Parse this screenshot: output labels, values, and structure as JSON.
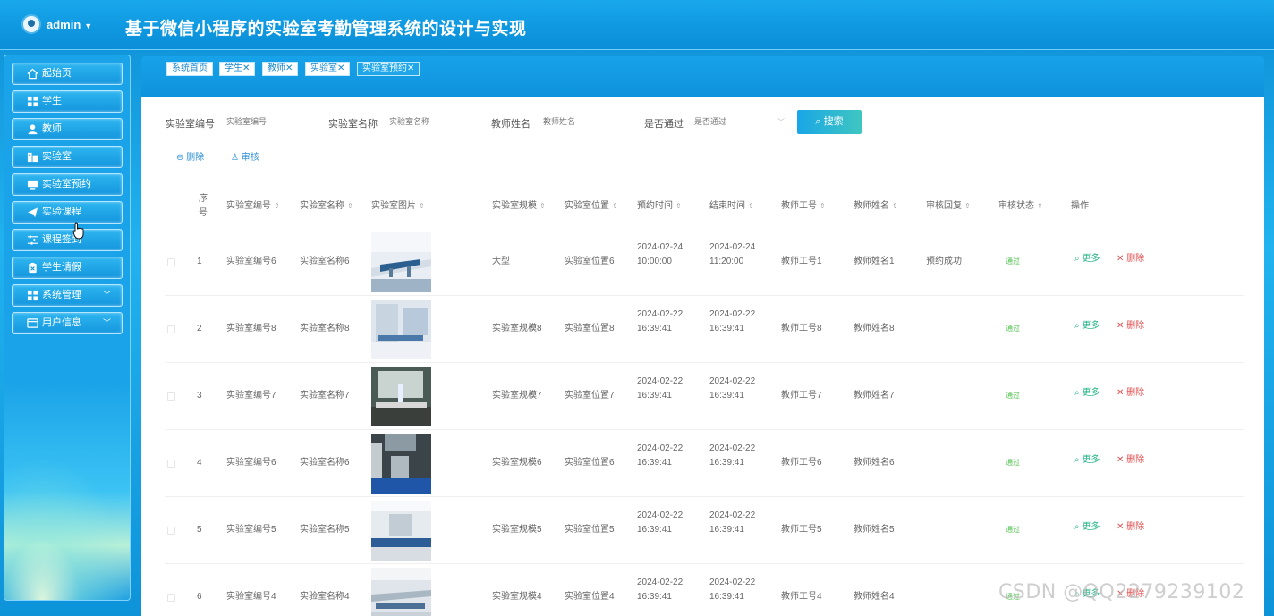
{
  "header": {
    "user": "admin",
    "title": "基于微信小程序的实验室考勤管理系统的设计与实现"
  },
  "sidebar": {
    "items": [
      {
        "label": "起始页",
        "icon": "home-icon"
      },
      {
        "label": "学生",
        "icon": "grid-icon"
      },
      {
        "label": "教师",
        "icon": "user-icon"
      },
      {
        "label": "实验室",
        "icon": "building-icon"
      },
      {
        "label": "实验室预约",
        "icon": "monitor-icon"
      },
      {
        "label": "实验课程",
        "icon": "paper-plane-icon"
      },
      {
        "label": "课程签到",
        "icon": "sliders-icon"
      },
      {
        "label": "学生请假",
        "icon": "clipboard-icon"
      },
      {
        "label": "系统管理",
        "icon": "grid-icon"
      },
      {
        "label": "用户信息",
        "icon": "card-icon"
      }
    ]
  },
  "tabs": [
    {
      "label": "系统首页"
    },
    {
      "label": "学生"
    },
    {
      "label": "教师"
    },
    {
      "label": "实验室"
    },
    {
      "label": "实验室预约"
    }
  ],
  "tab_close": "✕",
  "filters": {
    "lab_no_label": "实验室编号",
    "lab_no_placeholder": "实验室编号",
    "lab_name_label": "实验室名称",
    "lab_name_placeholder": "实验室名称",
    "teacher_name_label": "教师姓名",
    "teacher_name_placeholder": "教师姓名",
    "passed_label": "是否通过",
    "passed_placeholder": "是否通过",
    "search": "搜索"
  },
  "toolbar": {
    "delete": "删除",
    "review": "审核"
  },
  "table": {
    "headers": [
      "序号",
      "实验室编号",
      "实验室名称",
      "实验室图片",
      "实验室规模",
      "实验室位置",
      "预约时间",
      "结束时间",
      "教师工号",
      "教师姓名",
      "审核回复",
      "审核状态",
      "操作"
    ],
    "rows": [
      {
        "no": "1",
        "lab_no": "实验室编号6",
        "lab_name": "实验室名称6",
        "scale": "大型",
        "location": "实验室位置6",
        "start_date": "2024-02-24",
        "start_time": "10:00:00",
        "end_date": "2024-02-24",
        "end_time": "11:20:00",
        "teacher_no": "教师工号1",
        "teacher_name": "教师姓名1",
        "reply": "预约成功",
        "status": "通过"
      },
      {
        "no": "2",
        "lab_no": "实验室编号8",
        "lab_name": "实验室名称8",
        "scale": "实验室规模8",
        "location": "实验室位置8",
        "start_date": "2024-02-22",
        "start_time": "16:39:41",
        "end_date": "2024-02-22",
        "end_time": "16:39:41",
        "teacher_no": "教师工号8",
        "teacher_name": "教师姓名8",
        "reply": "",
        "status": "通过"
      },
      {
        "no": "3",
        "lab_no": "实验室编号7",
        "lab_name": "实验室名称7",
        "scale": "实验室规模7",
        "location": "实验室位置7",
        "start_date": "2024-02-22",
        "start_time": "16:39:41",
        "end_date": "2024-02-22",
        "end_time": "16:39:41",
        "teacher_no": "教师工号7",
        "teacher_name": "教师姓名7",
        "reply": "",
        "status": "通过"
      },
      {
        "no": "4",
        "lab_no": "实验室编号6",
        "lab_name": "实验室名称6",
        "scale": "实验室规模6",
        "location": "实验室位置6",
        "start_date": "2024-02-22",
        "start_time": "16:39:41",
        "end_date": "2024-02-22",
        "end_time": "16:39:41",
        "teacher_no": "教师工号6",
        "teacher_name": "教师姓名6",
        "reply": "",
        "status": "通过"
      },
      {
        "no": "5",
        "lab_no": "实验室编号5",
        "lab_name": "实验室名称5",
        "scale": "实验室规模5",
        "location": "实验室位置5",
        "start_date": "2024-02-22",
        "start_time": "16:39:41",
        "end_date": "2024-02-22",
        "end_time": "16:39:41",
        "teacher_no": "教师工号5",
        "teacher_name": "教师姓名5",
        "reply": "",
        "status": "通过"
      },
      {
        "no": "6",
        "lab_no": "实验室编号4",
        "lab_name": "实验室名称4",
        "scale": "实验室规模4",
        "location": "实验室位置4",
        "start_date": "2024-02-22",
        "start_time": "16:39:41",
        "end_date": "2024-02-22",
        "end_time": "16:39:41",
        "teacher_no": "教师工号4",
        "teacher_name": "教师姓名4",
        "reply": "",
        "status": "通过"
      }
    ],
    "action_more": "更多",
    "action_delete": "删除"
  },
  "watermark": "CSDN @QQ2279239102",
  "colors": {
    "accent": "#1aa3e8",
    "status_pass": "#53c153",
    "delete": "#e05050",
    "more": "#24b486"
  }
}
